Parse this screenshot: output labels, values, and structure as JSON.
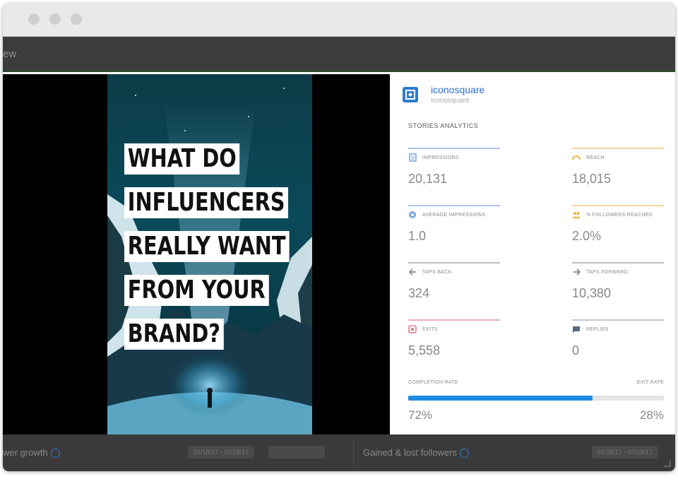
{
  "appbar": {
    "view_label": "ew"
  },
  "story": {
    "headline": [
      "WHAT DO",
      "INFLUENCERS",
      "REALLY WANT",
      "FROM YOUR",
      "BRAND?"
    ]
  },
  "panel": {
    "brand_name": "iconosquare",
    "brand_handle": "iconosquare",
    "section_title": "STORIES ANALYTICS",
    "metrics": [
      {
        "label": "IMPRESSIONS",
        "value": "20,131",
        "icon": "document-icon",
        "color": "#a8c4e8"
      },
      {
        "label": "REACH",
        "value": "18,015",
        "icon": "reach-icon",
        "color": "#f5d49a"
      },
      {
        "label": "AVERAGE IMPRESSIONS",
        "value": "1.0",
        "icon": "average-icon",
        "color": "#a8c4e8"
      },
      {
        "label": "% FOLLOWERS REACHED",
        "value": "2.0%",
        "icon": "followers-icon",
        "color": "#f5d49a"
      },
      {
        "label": "TAPS BACK",
        "value": "324",
        "icon": "arrow-left-icon",
        "color": "#bdbdbd"
      },
      {
        "label": "TAPS FORWARD",
        "value": "10,380",
        "icon": "arrow-right-icon",
        "color": "#bdbdbd"
      },
      {
        "label": "EXITS",
        "value": "5,558",
        "icon": "exit-icon",
        "color": "#f0b0b8"
      },
      {
        "label": "REPLIES",
        "value": "0",
        "icon": "replies-icon",
        "color": "#c0cad8"
      }
    ],
    "completion": {
      "left_label": "COMPLETION RATE",
      "right_label": "EXIT RATE",
      "left_value": "72%",
      "right_value": "28%",
      "fraction": 0.72
    }
  },
  "bottom": {
    "left_text": "wer growth",
    "left_pill": "01/18/17 - 07/18/17",
    "right_text": "Gained & lost followers",
    "right_pill": "01/18/17 - 07/18/17"
  },
  "colors": {
    "accent": "#1e8ae0",
    "brand": "#2a6ed0"
  }
}
